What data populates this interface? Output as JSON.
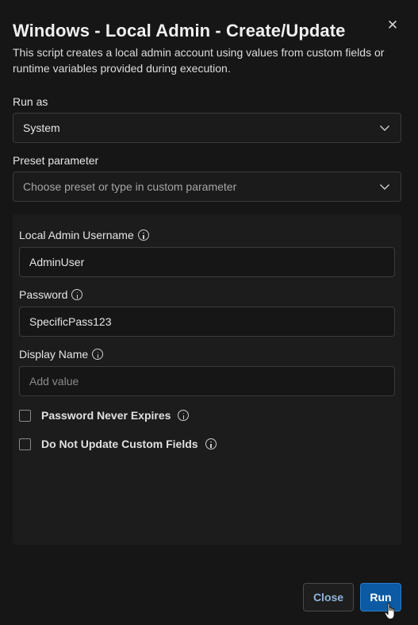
{
  "dialog": {
    "title": "Windows - Local Admin - Create/Update",
    "description": "This script creates a local admin account using values from custom fields or runtime variables provided during execution."
  },
  "run_as": {
    "label": "Run as",
    "value": "System"
  },
  "preset": {
    "label": "Preset parameter",
    "placeholder": "Choose preset or type in custom parameter"
  },
  "params": {
    "username": {
      "label": "Local Admin Username",
      "value": "AdminUser"
    },
    "password": {
      "label": "Password",
      "value": "SpecificPass123"
    },
    "display_name": {
      "label": "Display Name",
      "value": "",
      "placeholder": "Add value"
    },
    "never_expires": {
      "label": "Password Never Expires",
      "checked": false
    },
    "no_update_fields": {
      "label": "Do Not Update Custom Fields",
      "checked": false
    }
  },
  "footer": {
    "close_label": "Close",
    "run_label": "Run"
  },
  "colors": {
    "background": "#161616",
    "panel": "#1c1c1c",
    "primary": "#0b5aa3",
    "link": "#8fb4dc"
  },
  "icons": [
    "close-icon",
    "chevron-down-icon",
    "info-icon",
    "hand-cursor-icon"
  ]
}
